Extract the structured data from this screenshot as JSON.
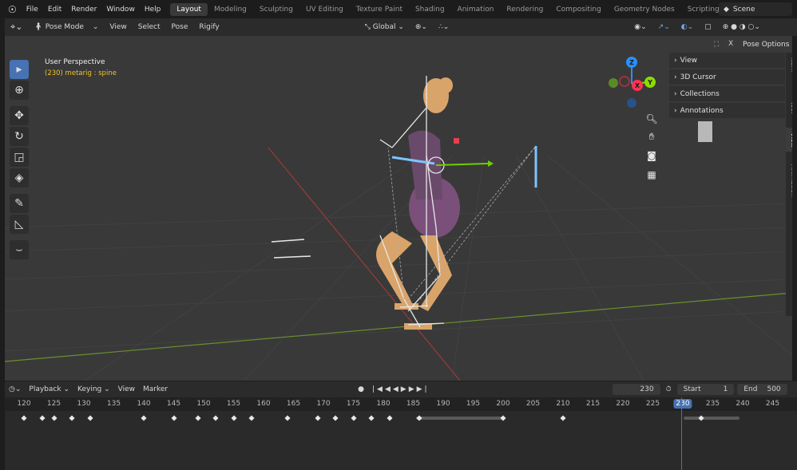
{
  "topbar": {
    "menus": [
      "File",
      "Edit",
      "Render",
      "Window",
      "Help"
    ],
    "workspaces": [
      "Layout",
      "Modeling",
      "Sculpting",
      "UV Editing",
      "Texture Paint",
      "Shading",
      "Animation",
      "Rendering",
      "Compositing",
      "Geometry Nodes",
      "Scripting"
    ],
    "active_workspace": "Layout",
    "scene_name": "Scene"
  },
  "header": {
    "mode": "Pose Mode",
    "menus": [
      "View",
      "Select",
      "Pose",
      "Rigify"
    ],
    "transform_orientation": "Global",
    "pose_options": "Pose Options"
  },
  "viewport": {
    "info_title": "User Perspective",
    "info_sub": "(230) metarig : spine",
    "gizmo_axes": [
      "Z",
      "X",
      "Y"
    ]
  },
  "npanel": {
    "items": [
      "View",
      "3D Cursor",
      "Collections",
      "Annotations"
    ],
    "tabs": [
      "Item",
      "Tool",
      "View",
      "Animation"
    ],
    "active_tab": "View"
  },
  "timeline": {
    "menus": [
      "Playback",
      "Keying",
      "View",
      "Marker"
    ],
    "current_frame": "230",
    "start_label": "Start",
    "start_value": "1",
    "end_label": "End",
    "end_value": "500",
    "ruler_ticks": [
      "120",
      "125",
      "130",
      "135",
      "140",
      "145",
      "150",
      "155",
      "160",
      "165",
      "170",
      "175",
      "180",
      "185",
      "190",
      "195",
      "200",
      "205",
      "210",
      "215",
      "220",
      "225",
      "230",
      "235",
      "240",
      "245"
    ],
    "keyframes": [
      120,
      123,
      125,
      128,
      131,
      140,
      145,
      149,
      152,
      155,
      158,
      164,
      169,
      172,
      175,
      178,
      181,
      186,
      200,
      210,
      233
    ]
  },
  "colors": {
    "accent": "#4772b3",
    "axis_x": "#ff3352",
    "axis_y": "#8bdc00",
    "axis_z": "#2890ff",
    "info_sub": "#f0c030"
  }
}
